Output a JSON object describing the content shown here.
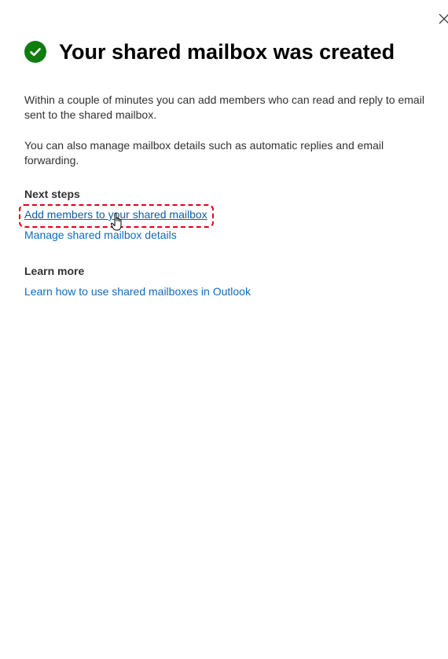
{
  "dialog": {
    "title": "Your shared mailbox was created",
    "close_icon": "close-icon",
    "status_icon": "checkmark-circle-icon",
    "status_color": "#107c10"
  },
  "body": {
    "paragraph_1": "Within a couple of minutes you can add members who can read and reply to email sent to the shared mailbox.",
    "paragraph_2": "You can also manage mailbox details such as automatic replies and email forwarding."
  },
  "next_steps": {
    "heading": "Next steps",
    "links": [
      {
        "label": "Add members to your shared mailbox"
      },
      {
        "label": "Manage shared mailbox details"
      }
    ]
  },
  "learn_more": {
    "heading": "Learn more",
    "link_label": "Learn how to use shared mailboxes in Outlook"
  },
  "colors": {
    "link": "#0f6cbd",
    "highlight": "#e3001b"
  }
}
